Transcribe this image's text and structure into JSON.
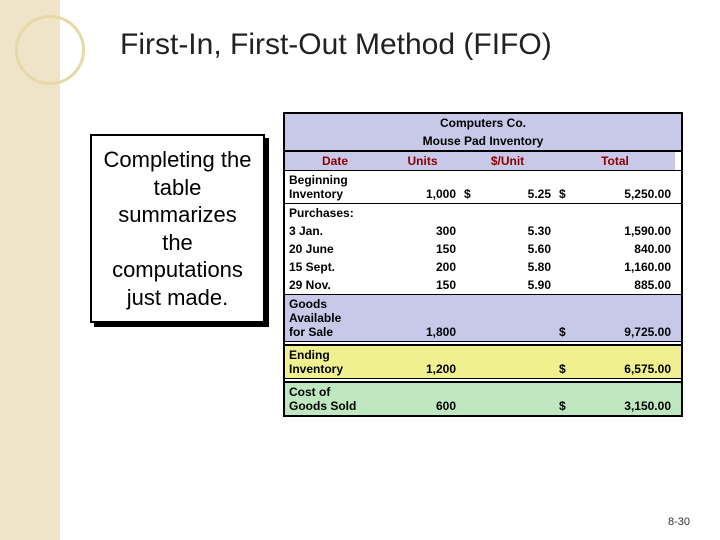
{
  "title": "First-In, First-Out Method (FIFO)",
  "callout": "Completing the table summarizes the computations just made.",
  "pagenum": "8-30",
  "table": {
    "title1": "Computers Co.",
    "title2": "Mouse Pad Inventory",
    "headers": {
      "date": "Date",
      "units": "Units",
      "unit": "$/Unit",
      "total": "Total"
    },
    "beginning": {
      "label": "Beginning Inventory",
      "units": "1,000",
      "unit_prefix": "$",
      "unit": "5.25",
      "total_prefix": "$",
      "total": "5,250.00"
    },
    "purchases_label": "Purchases:",
    "purchases": [
      {
        "date": "3 Jan.",
        "units": "300",
        "unit": "5.30",
        "total": "1,590.00"
      },
      {
        "date": "20 June",
        "units": "150",
        "unit": "5.60",
        "total": "840.00"
      },
      {
        "date": "15 Sept.",
        "units": "200",
        "unit": "5.80",
        "total": "1,160.00"
      },
      {
        "date": "29 Nov.",
        "units": "150",
        "unit": "5.90",
        "total": "885.00"
      }
    ],
    "available": {
      "label1": "Goods",
      "label2": "Available",
      "label3": "for Sale",
      "units": "1,800",
      "total_prefix": "$",
      "total": "9,725.00"
    },
    "ending": {
      "label1": "Ending",
      "label2": "Inventory",
      "units": "1,200",
      "total_prefix": "$",
      "total": "6,575.00"
    },
    "cogs": {
      "label1": "Cost of",
      "label2": "Goods Sold",
      "units": "600",
      "total_prefix": "$",
      "total": "3,150.00"
    }
  },
  "chart_data": {
    "type": "table",
    "title": "Computers Co. Mouse Pad Inventory — FIFO",
    "columns": [
      "Date",
      "Units",
      "$/Unit",
      "Total"
    ],
    "rows": [
      [
        "Beginning Inventory",
        1000,
        5.25,
        5250.0
      ],
      [
        "3 Jan.",
        300,
        5.3,
        1590.0
      ],
      [
        "20 June",
        150,
        5.6,
        840.0
      ],
      [
        "15 Sept.",
        200,
        5.8,
        1160.0
      ],
      [
        "29 Nov.",
        150,
        5.9,
        885.0
      ],
      [
        "Goods Available for Sale",
        1800,
        null,
        9725.0
      ],
      [
        "Ending Inventory",
        1200,
        null,
        6575.0
      ],
      [
        "Cost of Goods Sold",
        600,
        null,
        3150.0
      ]
    ]
  }
}
